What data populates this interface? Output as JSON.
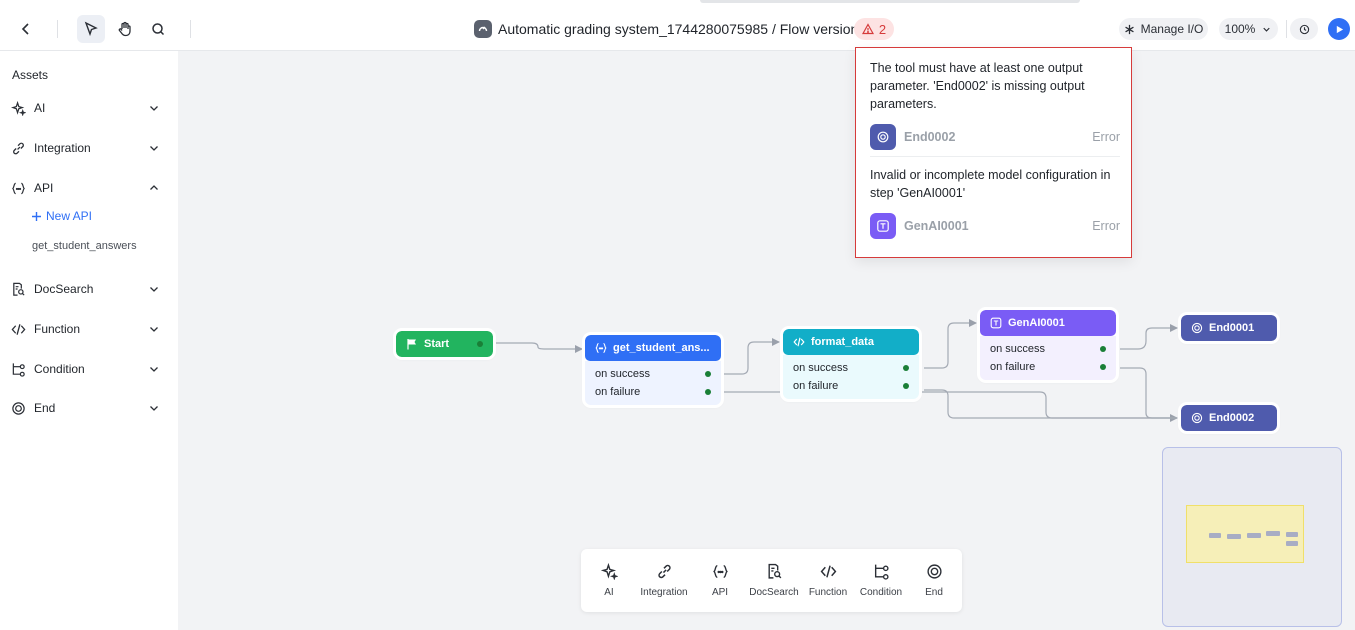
{
  "header": {
    "title": "Automatic grading system_1744280075985 / Flow versions",
    "error_count": "2",
    "manage_io_label": "Manage I/O",
    "zoom_label": "100%"
  },
  "sidebar": {
    "title": "Assets",
    "items": [
      {
        "label": "AI",
        "icon": "sparkle-icon",
        "expanded": false
      },
      {
        "label": "Integration",
        "icon": "link-icon",
        "expanded": false
      },
      {
        "label": "API",
        "icon": "braces-icon",
        "expanded": true
      },
      {
        "label": "DocSearch",
        "icon": "doc-search-icon",
        "expanded": false
      },
      {
        "label": "Function",
        "icon": "code-icon",
        "expanded": false
      },
      {
        "label": "Condition",
        "icon": "condition-icon",
        "expanded": false
      },
      {
        "label": "End",
        "icon": "end-icon",
        "expanded": false
      }
    ],
    "api_new_label": "New API",
    "api_sub_item": "get_student_answers"
  },
  "nodes": {
    "start": {
      "label": "Start",
      "color": "#22b45f"
    },
    "get_student": {
      "label": "get_student_ans...",
      "color": "#2f6ff5",
      "success": "on success",
      "failure": "on failure"
    },
    "format_data": {
      "label": "format_data",
      "color": "#12aec8",
      "success": "on success",
      "failure": "on failure"
    },
    "genai": {
      "label": "GenAI0001",
      "color": "#7a5cf5",
      "success": "on success",
      "failure": "on failure"
    },
    "end1": {
      "label": "End0001",
      "color": "#4f5bad"
    },
    "end2": {
      "label": "End0002",
      "color": "#4f5bad"
    }
  },
  "toolbar": {
    "items": [
      {
        "label": "AI",
        "icon": "sparkle-icon"
      },
      {
        "label": "Integration",
        "icon": "link-icon"
      },
      {
        "label": "API",
        "icon": "braces-icon"
      },
      {
        "label": "DocSearch",
        "icon": "doc-search-icon"
      },
      {
        "label": "Function",
        "icon": "code-icon"
      },
      {
        "label": "Condition",
        "icon": "condition-icon"
      },
      {
        "label": "End",
        "icon": "end-icon"
      }
    ]
  },
  "errors": {
    "items": [
      {
        "message": "The tool must have at least one output parameter. 'End0002' is missing output parameters.",
        "node": "End0002",
        "type": "Error",
        "icon_color": "#4f5bad"
      },
      {
        "message": "Invalid or incomplete model configuration in step 'GenAI0001'",
        "node": "GenAI0001",
        "type": "Error",
        "icon_color": "#7a5cf5"
      }
    ]
  },
  "colors": {
    "accent": "#2f6ff5",
    "error": "#d63b3b"
  }
}
